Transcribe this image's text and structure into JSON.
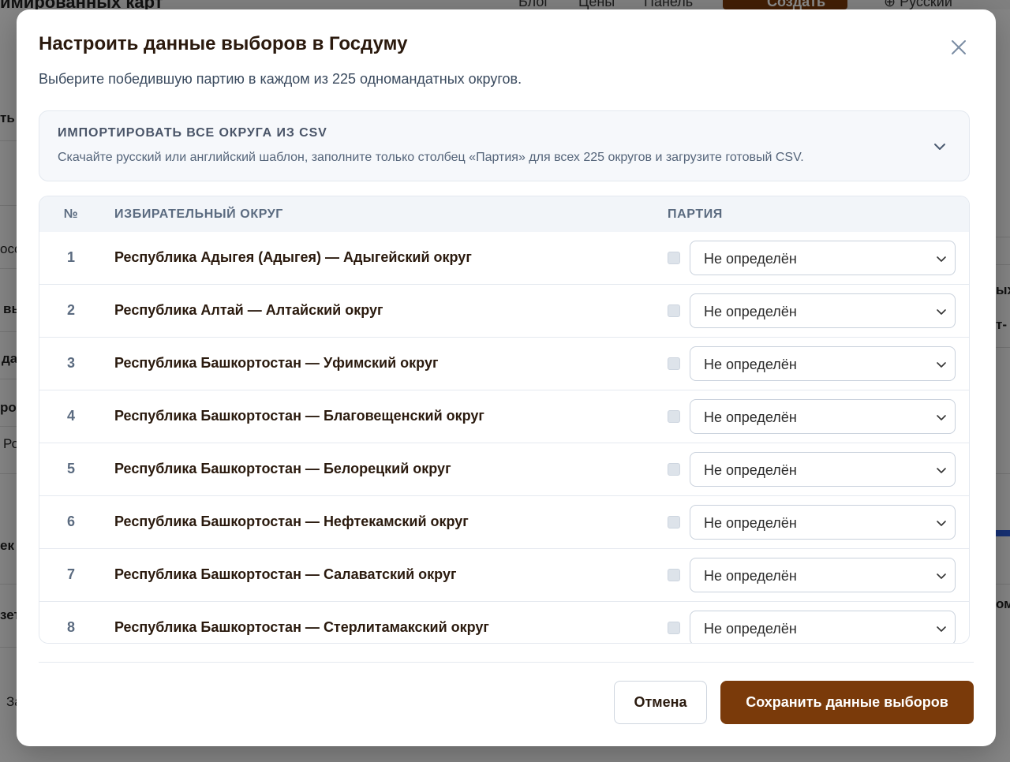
{
  "background": {
    "title_fragment": "имированных карт",
    "nav": [
      "Блог",
      "Цены",
      "Панель"
    ],
    "create_label": "Создать",
    "language_label": "Русский",
    "left_fragments": [
      "ть",
      "осс",
      "вь",
      "да",
      "ров",
      "Ро",
      "ек",
      "зет",
      "За"
    ],
    "right_fragments": [
      "ых",
      "т-",
      "ом"
    ]
  },
  "modal": {
    "title": "Настроить данные выборов в Госдуму",
    "subtitle": "Выберите победившую партию в каждом из 225 одномандатных округов.",
    "import": {
      "title": "ИМПОРТИРОВАТЬ ВСЕ ОКРУГА ИЗ CSV",
      "description": "Скачайте русский или английский шаблон, заполните только столбец «Партия» для всех 225 округов и загрузите готовый CSV."
    },
    "table": {
      "headers": {
        "num": "№",
        "district": "ИЗБИРАТЕЛЬНЫЙ ОКРУГ",
        "party": "ПАРТИЯ"
      },
      "rows": [
        {
          "num": "1",
          "name": "Республика Адыгея (Адыгея) — Адыгейский округ",
          "party": "Не определён"
        },
        {
          "num": "2",
          "name": "Республика Алтай — Алтайский округ",
          "party": "Не определён"
        },
        {
          "num": "3",
          "name": "Республика Башкортостан — Уфимский округ",
          "party": "Не определён"
        },
        {
          "num": "4",
          "name": "Республика Башкортостан — Благовещенский округ",
          "party": "Не определён"
        },
        {
          "num": "5",
          "name": "Республика Башкортостан — Белорецкий округ",
          "party": "Не определён"
        },
        {
          "num": "6",
          "name": "Республика Башкортостан — Нефтекамский округ",
          "party": "Не определён"
        },
        {
          "num": "7",
          "name": "Республика Башкортостан — Салаватский округ",
          "party": "Не определён"
        },
        {
          "num": "8",
          "name": "Республика Башкортостан — Стерлитамакский округ",
          "party": "Не определён"
        }
      ]
    },
    "buttons": {
      "cancel": "Отмена",
      "save": "Сохранить данные выборов"
    }
  },
  "colors": {
    "accent": "#7a3a0a",
    "title": "#2b1a0e",
    "muted": "#5b6b80"
  },
  "icons": {
    "close": "close-icon",
    "import_toggle": "chevron-down-icon",
    "select": "chevron-down-icon",
    "create": "sparkle-icon",
    "language": "globe-icon"
  }
}
